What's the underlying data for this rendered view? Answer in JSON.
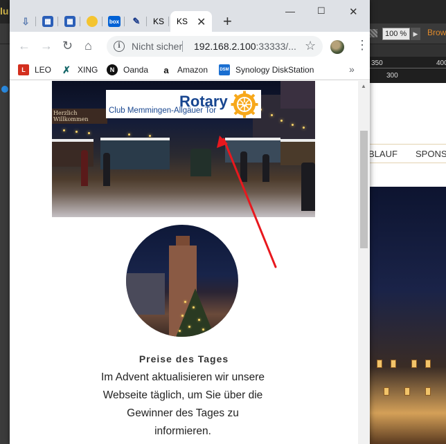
{
  "background_app": {
    "zoom": "100 %",
    "browse_label": "Brow",
    "ruler": {
      "tick_350": "350",
      "tick_400": "400",
      "tick_300": "300"
    },
    "preview_nav": {
      "item_1": "BLAUF",
      "item_2": "SPONS"
    },
    "accent_color": "#e08a2b"
  },
  "browser": {
    "tabs": [
      {
        "icon": "download-icon"
      },
      {
        "icon": "gallery-icon"
      },
      {
        "icon": "gallery-icon"
      },
      {
        "icon": "sun-icon"
      },
      {
        "icon": "box-icon",
        "label": "box"
      },
      {
        "icon": "edit-icon"
      },
      {
        "icon": "ks-icon",
        "label": "KS"
      },
      {
        "icon": "ks-icon",
        "label": "KS",
        "active": true
      }
    ],
    "address": {
      "security": "Nicht sicher",
      "url_host": "192.168.2.100",
      "url_rest": ":33333/..."
    },
    "bookmarks": [
      {
        "label": "LEO",
        "color": "#e8a020"
      },
      {
        "label": "XING",
        "color": "#126567"
      },
      {
        "label": "Oanda",
        "color": "#111111"
      },
      {
        "label": "Amazon",
        "color": "#111111"
      },
      {
        "label": "Synology DiskStation",
        "color": "#1a6fd1"
      }
    ],
    "more": "»"
  },
  "page": {
    "logo": {
      "name": "Rotary",
      "club": "Club Memmingen-Allgäuer Tor"
    },
    "hero_sign": "Herzlich Willkommen",
    "prize": {
      "title": "Preise des Tages",
      "text": "Im Advent aktualisieren wir unsere Webseite täglich, um Sie über die Gewinner des Tages zu informieren."
    }
  },
  "annotation": {
    "color": "#e8181e"
  }
}
